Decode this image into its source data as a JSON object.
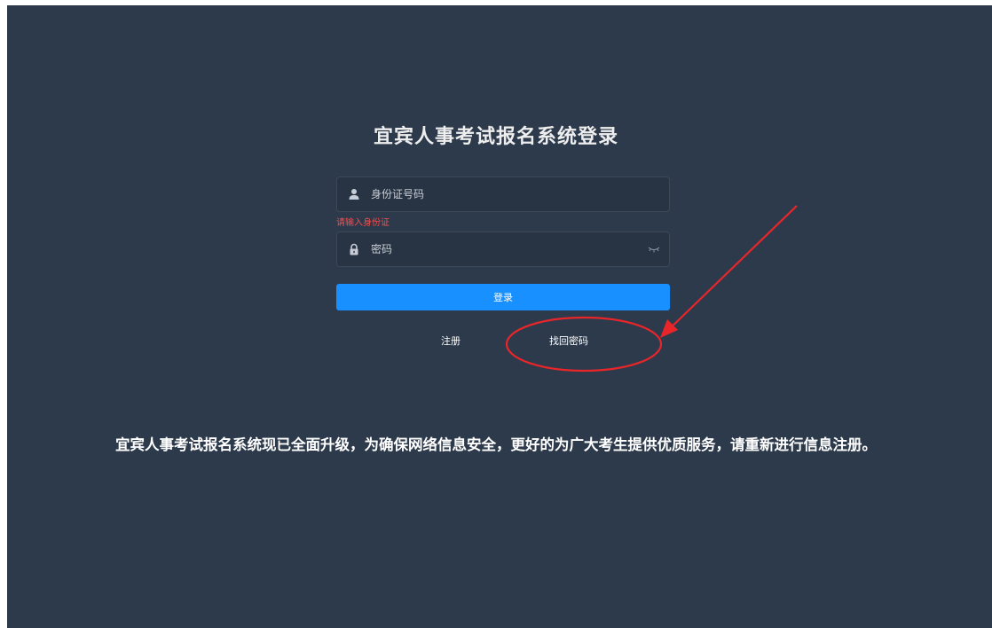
{
  "login": {
    "title": "宜宾人事考试报名系统登录",
    "id_field": {
      "placeholder": "身份证号码",
      "value": "",
      "error": "请输入身份证"
    },
    "password_field": {
      "placeholder": "密码",
      "value": ""
    },
    "login_label": "登录",
    "register_label": "注册",
    "forgot_label": "找回密码"
  },
  "notice": "宜宾人事考试报名系统现已全面升级，为确保网络信息安全，更好的为广大考生提供优质服务，请重新进行信息注册。",
  "icons": {
    "user": "user-icon",
    "lock": "lock-icon",
    "eye": "eye-closed-icon"
  },
  "colors": {
    "background": "#2d3a4b",
    "input_bg": "#283443",
    "primary": "#1890ff",
    "error": "#ff4949",
    "annotation": "#e8262a"
  }
}
